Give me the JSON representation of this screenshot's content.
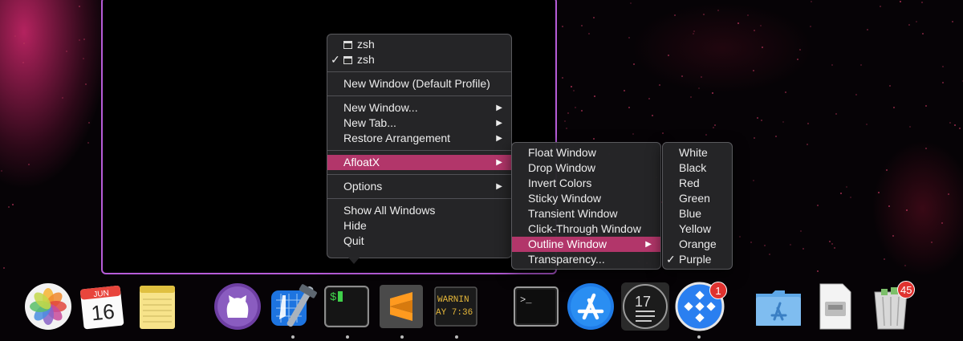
{
  "menu_main": {
    "windows": [
      {
        "label": "zsh",
        "checked": false
      },
      {
        "label": "zsh",
        "checked": true
      }
    ],
    "new_window_default": "New Window (Default Profile)",
    "new_window": "New Window...",
    "new_tab": "New Tab...",
    "restore_arrangement": "Restore Arrangement",
    "afloatx": "AfloatX",
    "options": "Options",
    "show_all_windows": "Show All Windows",
    "hide": "Hide",
    "quit": "Quit",
    "check_glyph": "✓",
    "arrow_glyph": "▶"
  },
  "menu_afloatx": {
    "items": [
      "Float Window",
      "Drop Window",
      "Invert Colors",
      "Sticky Window",
      "Transient Window",
      "Click-Through Window",
      "Outline Window",
      "Transparency..."
    ],
    "highlighted": "Outline Window"
  },
  "menu_colors": {
    "items": [
      "White",
      "Black",
      "Red",
      "Green",
      "Blue",
      "Yellow",
      "Orange",
      "Purple"
    ],
    "checked": "Purple"
  },
  "dock": {
    "calendar_month": "JUN",
    "calendar_day": "16",
    "terminal_prompt": "$",
    "console_line1": "WARNIN",
    "console_line2": "AY 7:36",
    "terminal2_prompt": ">_",
    "clock_number": "17",
    "yoink_badge": "1",
    "trash_badge": "45"
  },
  "colors": {
    "highlight": "#b2366a",
    "outline": "#b65cd8",
    "menu_bg": "#262628"
  }
}
